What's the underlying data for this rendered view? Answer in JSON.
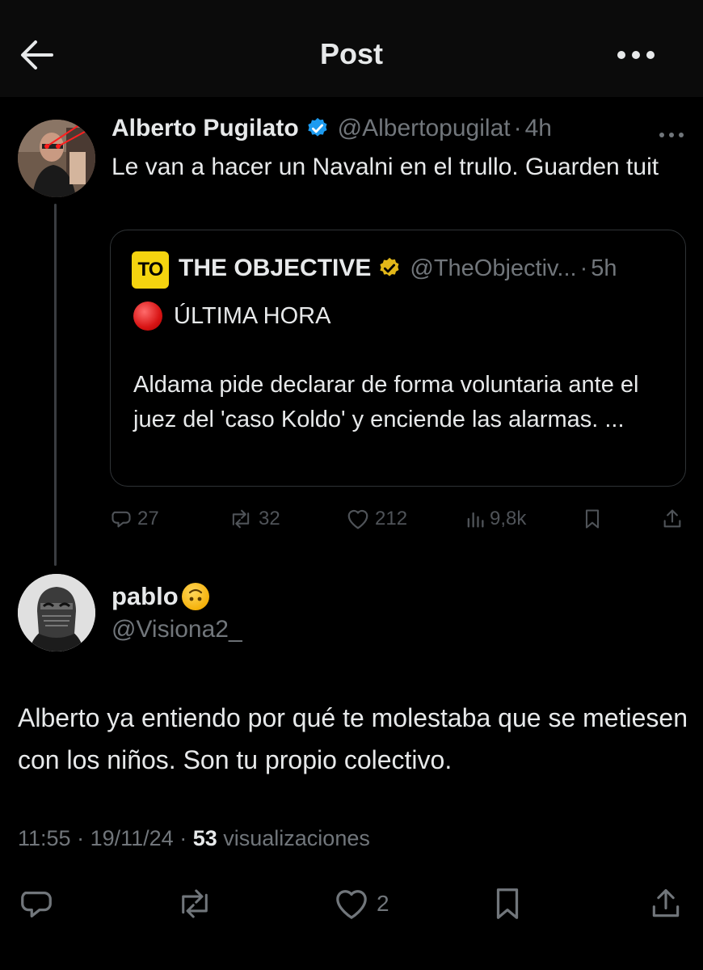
{
  "header": {
    "title": "Post"
  },
  "tweet": {
    "author": {
      "name": "Alberto Pugilato",
      "handle": "@Albertopugilat",
      "time": "4h"
    },
    "text": "Le van a hacer un Navalni en el trullo. Guarden tuit",
    "quote": {
      "logo": "TO",
      "name": "THE OBJECTIVE",
      "handle": "@TheObjectiv...",
      "time": "5h",
      "headline": "ÚLTIMA HORA",
      "body": "Aldama pide declarar de forma voluntaria ante el juez del 'caso Koldo' y enciende las alarmas. ..."
    },
    "stats": {
      "replies": "27",
      "reposts": "32",
      "likes": "212",
      "views": "9,8k"
    }
  },
  "reply": {
    "author": {
      "name": "pablo",
      "handle": "@Visiona2_"
    },
    "text": "Alberto ya entiendo por qué te molestaba que se metiesen con los niños. Son tu propio colectivo.",
    "time": "11:55",
    "date": "19/11/24",
    "views_count": "53",
    "views_label": "visualizaciones",
    "likes": "2"
  },
  "colors": {
    "background": "#000000",
    "text": "#e7e9ea",
    "secondary": "#71767b",
    "verified_blue": "#1d9bf0",
    "verified_gold": "#e2b719",
    "border": "#2f3336"
  }
}
